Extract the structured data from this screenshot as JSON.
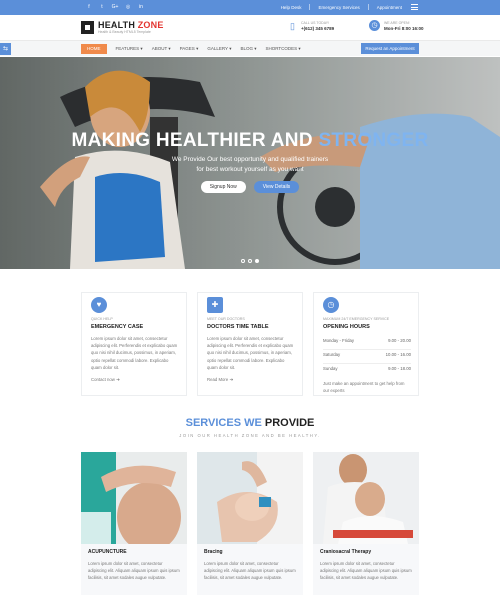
{
  "topbar": {
    "social_icons": [
      "facebook-icon",
      "twitter-icon",
      "google-plus-icon",
      "instagram-icon",
      "linkedin-icon"
    ],
    "social_glyphs": [
      "f",
      "t",
      "G+",
      "◎",
      "in"
    ],
    "links": [
      "Help Desk",
      "Emergency Services",
      "Appointment"
    ]
  },
  "header": {
    "logo_name_1": "HEALTH ",
    "logo_name_2": "ZONE",
    "logo_tagline": "Health & Beauty HTML5 Template",
    "call_label": "CALL US TODAY!",
    "call_value": "+(612) 345 6789",
    "hours_label": "WE ARE OPEN!",
    "hours_value": "Mon-Fri 8:00 16:00"
  },
  "nav": {
    "items": [
      "HOME",
      "FEATURES",
      "ABOUT",
      "PAGES",
      "GALLERY",
      "BLOG",
      "SHORTCODES"
    ],
    "dropdown_marks": [
      "",
      " ▾",
      " ▾",
      " ▾",
      " ▾",
      " ▾",
      " ▾"
    ],
    "appointment_label": "Request an Appointment"
  },
  "hero": {
    "title_1": "MAKING HEALTHIER AND ",
    "title_2": "STRONGER",
    "sub_1": "We Provide Our best opportunity and qualified trainers",
    "sub_2": "for best workout yourself as you want",
    "btn_signup": "Signup Now",
    "btn_details": "View Details"
  },
  "boxes": [
    {
      "small": "QUICK HELP",
      "head": "EMERGENCY CASE",
      "body": "Lorem ipsum dolor sit amet, consectetur adipiscing elit. Perferendis et explicabo quam quo nisi nihil ducimus, possimus, in aperiam, optio repellat commodi labore. Explicabo quam dolor sit.",
      "more": "Contact now  ➜"
    },
    {
      "small": "MEET OUR DOCTORS",
      "head": "DOCTORS TIME TABLE",
      "body": "Lorem ipsum dolor sit amet, consectetur adipiscing elit. Perferendis et explicabo quam quo nisi nihil ducimus, possimus, in aperiam, optio repellat commodi labore. Explicabo quam dolor sit.",
      "more": "Read More  ➜"
    },
    {
      "small": "MAXIMUM 24/7 EMERGENCY SERVICE",
      "head": "OPENING HOURS",
      "hours": [
        {
          "day": "Monday - Friday",
          "time": "9.00 - 20.00"
        },
        {
          "day": "Saturday",
          "time": "10.00 - 16.00"
        },
        {
          "day": "Sunday",
          "time": "9.00 - 18.00"
        }
      ],
      "note": "Just make an appointment to get help from our experts"
    }
  ],
  "services": {
    "title_1": "SERVICES WE ",
    "title_2": "PROVIDE",
    "subtitle": "JOIN OUR HEALTH ZONE AND BE HEALTHY.",
    "cards": [
      {
        "title": "ACUPUNCTURE",
        "body": "Lorem ipsum dolor sit amet, consectetur adipiscing elit. Aliquam aliquam ipsum quis ipsum facilisis, sit amet sodales augue vulputate."
      },
      {
        "title": "Bracing",
        "body": "Lorem ipsum dolor sit amet, consectetur adipiscing elit. Aliquam aliquam ipsum quis ipsum facilisis, sit amet sodales augue vulputate."
      },
      {
        "title": "Craniosacral Therapy",
        "body": "Lorem ipsum dolor sit amet, consectetur adipiscing elit. Aliquam aliquam ipsum quis ipsum facilisis, sit amet sodales augue vulputate."
      }
    ]
  },
  "colors": {
    "accent": "#5b8fd9",
    "nav_active": "#f08a4b",
    "logo_red": "#e3342f"
  }
}
